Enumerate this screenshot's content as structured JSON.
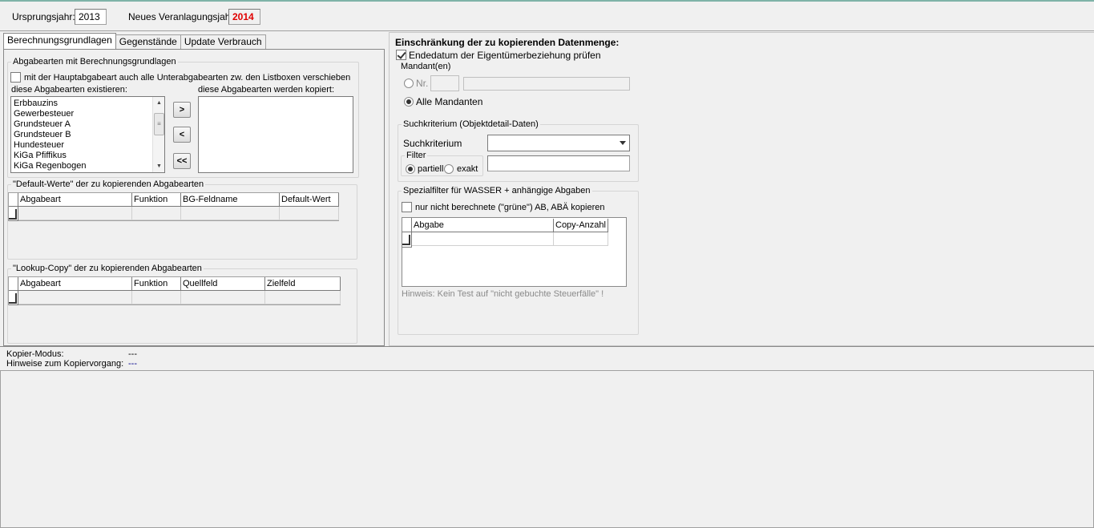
{
  "header": {
    "origin_year_label": "Ursprungsjahr:",
    "origin_year_value": "2013",
    "new_year_label": "Neues Veranlagungsjahr:",
    "new_year_value": "2014"
  },
  "tabs": [
    {
      "label": "Berechnungsgrundlagen",
      "active": true
    },
    {
      "label": "Gegenstände",
      "active": false
    },
    {
      "label": "Update Verbrauch",
      "active": false
    }
  ],
  "left": {
    "group_title": "Abgabearten mit Berechnungsgrundlagen",
    "move_sub_checkbox_label": "mit der Hauptabgabeart auch alle Unterabgabearten zw. den Listboxen verschieben",
    "existing_label": "diese Abgabearten existieren:",
    "copied_label": "diese Abgabearten werden kopiert:",
    "existing_items": [
      "Erbbauzins",
      "Gewerbesteuer",
      "Grundsteuer A",
      "Grundsteuer B",
      "Hundesteuer",
      "KiGa Pfiffikus",
      "KiGa Regenbogen"
    ],
    "btn_add": ">",
    "btn_remove": "<",
    "btn_remove_all": "<<",
    "default_group_title": "\"Default-Werte\" der zu kopierenden Abgabearten",
    "default_columns": [
      "Abgabeart",
      "Funktion",
      "BG-Feldname",
      "Default-Wert"
    ],
    "lookup_group_title": "\"Lookup-Copy\" der zu kopierenden Abgabearten",
    "lookup_columns": [
      "Abgabeart",
      "Funktion",
      "Quellfeld",
      "Zielfeld"
    ]
  },
  "right": {
    "title": "Einschränkung der zu kopierenden Datenmenge:",
    "end_date_checkbox_label": "Endedatum der Eigentümerbeziehung prüfen",
    "mandant_group_title": "Mandant(en)",
    "nr_label": "Nr.",
    "all_mandants_label": "Alle Mandanten",
    "search_group_title": "Suchkriterium (Objektdetail-Daten)",
    "search_label": "Suchkriterium",
    "filter_label": "Filter",
    "partial_label": "partiell",
    "exact_label": "exakt",
    "special_group_title": "Spezialfilter  für WASSER + anhängige Abgaben",
    "not_calculated_checkbox_label": "nur nicht berechnete (\"grüne\") AB, ABÄ kopieren",
    "special_columns": [
      "Abgabe",
      "Copy-Anzahl"
    ],
    "hint": "Hinweis: Kein Test auf \"nicht gebuchte Steuerfälle\" !"
  },
  "status": {
    "mode_label": "Kopier-Modus:",
    "mode_value": "---",
    "hints_label": "Hinweise zum Kopiervorgang:",
    "hints_value": "---"
  },
  "colors": {
    "new_year": "#e00000",
    "hints_value": "#00008b"
  }
}
